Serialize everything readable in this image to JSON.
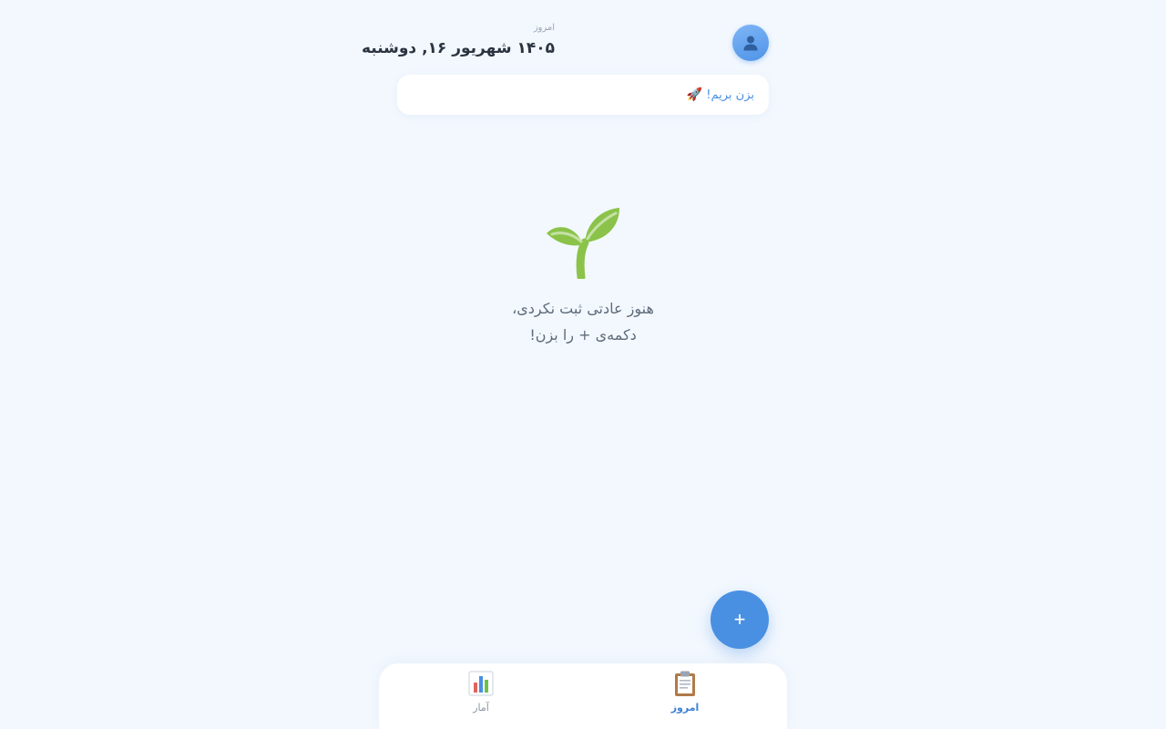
{
  "header": {
    "today_label": "امروز",
    "date": "۱۴۰۵ شهریور ۱۶, دوشنبه",
    "avatar_icon": "user-icon"
  },
  "motivation": {
    "text": "بزن بریم!",
    "icon": "🚀"
  },
  "empty_state": {
    "icon": "sprout-icon",
    "line1": "هنوز عادتی ثبت نکردی،",
    "line2": "دکمه‌ی + را بزن!"
  },
  "fab": {
    "label": "+"
  },
  "nav": {
    "today": {
      "label": "امروز",
      "icon": "clipboard-icon"
    },
    "stats": {
      "label": "آمار",
      "icon": "bar-chart-icon"
    }
  },
  "colors": {
    "accent": "#4a90e2",
    "background": "#f3f8fe",
    "text_dark": "#2b3440",
    "text_muted": "#9aa4b2"
  }
}
